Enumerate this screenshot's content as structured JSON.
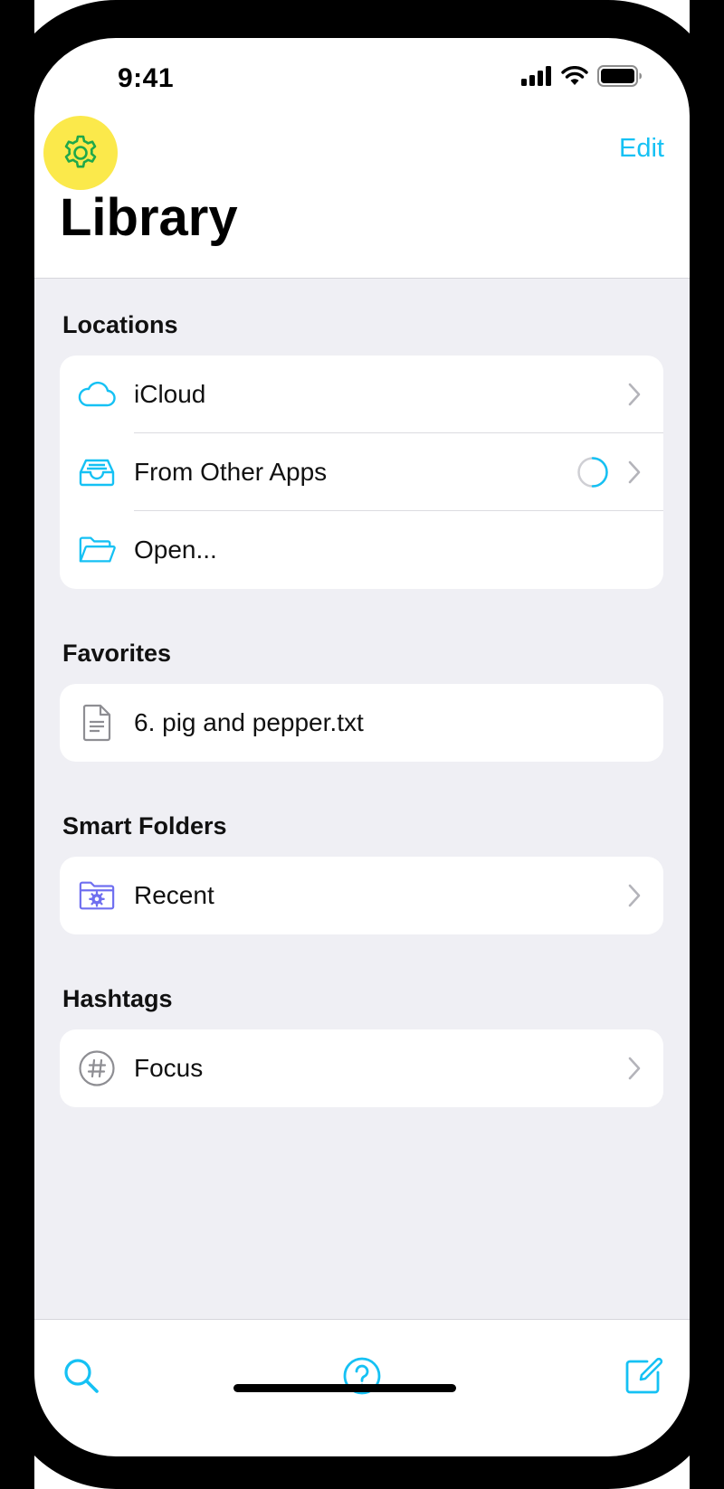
{
  "status_bar": {
    "time": "9:41"
  },
  "nav": {
    "settings_icon": "gear-icon",
    "edit_label": "Edit",
    "title": "Library"
  },
  "colors": {
    "accent": "#15c1f4",
    "highlight": "#fbe94b",
    "gear_green": "#1fa84a",
    "background": "#efeff4"
  },
  "sections": {
    "locations": {
      "label": "Locations",
      "items": [
        {
          "label": "iCloud",
          "icon": "cloud-icon",
          "chevron": true
        },
        {
          "label": "From Other Apps",
          "icon": "inbox-tray-icon",
          "chevron": true,
          "loading": true
        },
        {
          "label": "Open...",
          "icon": "folder-icon",
          "chevron": false
        }
      ]
    },
    "favorites": {
      "label": "Favorites",
      "items": [
        {
          "label": "6. pig and pepper.txt",
          "icon": "document-icon",
          "chevron": false
        }
      ]
    },
    "smart_folders": {
      "label": "Smart Folders",
      "items": [
        {
          "label": "Recent",
          "icon": "gear-folder-icon",
          "chevron": true
        }
      ]
    },
    "hashtags": {
      "label": "Hashtags",
      "items": [
        {
          "label": "Focus",
          "icon": "hashtag-icon",
          "chevron": true
        }
      ]
    }
  },
  "tabbar": {
    "items": [
      {
        "icon": "search-icon"
      },
      {
        "icon": "help-icon"
      },
      {
        "icon": "compose-icon"
      }
    ]
  }
}
